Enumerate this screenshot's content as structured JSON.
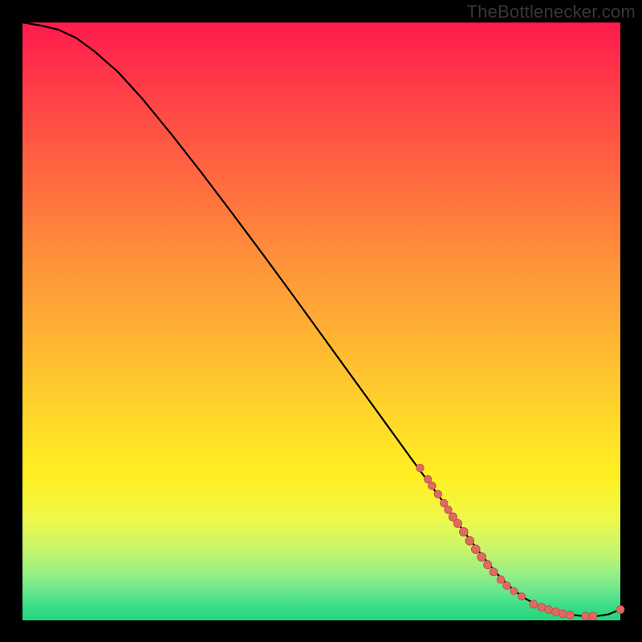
{
  "watermark": "TheBottlenecker.com",
  "colors": {
    "curve": "#000000",
    "marker_fill": "#e06a62",
    "marker_stroke": "#b94f47",
    "gradient_top": "#ff1a4e",
    "gradient_bottom": "#1fd77d"
  },
  "chart_data": {
    "type": "line",
    "title": "",
    "xlabel": "",
    "ylabel": "",
    "xlim": [
      0,
      100
    ],
    "ylim": [
      0,
      100
    ],
    "grid": false,
    "legend": false,
    "series": [
      {
        "name": "curve",
        "x": [
          0,
          3,
          6,
          9,
          12,
          16,
          20,
          25,
          30,
          35,
          40,
          45,
          50,
          55,
          60,
          65,
          70,
          74,
          78,
          80,
          82,
          84,
          86,
          88,
          90,
          92,
          94,
          96,
          98,
          100
        ],
        "y": [
          100,
          99.5,
          98.8,
          97.4,
          95.2,
          91.7,
          87.3,
          81.2,
          74.8,
          68.2,
          61.5,
          54.7,
          47.8,
          40.9,
          34.0,
          27.1,
          20.3,
          14.6,
          9.4,
          7.1,
          5.2,
          3.7,
          2.6,
          1.8,
          1.2,
          0.9,
          0.7,
          0.7,
          1.0,
          1.8
        ]
      }
    ],
    "markers": [
      {
        "x": 66.5,
        "y": 25.5,
        "r": 4.8
      },
      {
        "x": 67.8,
        "y": 23.6,
        "r": 4.8
      },
      {
        "x": 68.5,
        "y": 22.5,
        "r": 4.8
      },
      {
        "x": 69.5,
        "y": 21.1,
        "r": 4.8
      },
      {
        "x": 70.5,
        "y": 19.6,
        "r": 4.8
      },
      {
        "x": 71.2,
        "y": 18.5,
        "r": 4.8
      },
      {
        "x": 72.0,
        "y": 17.3,
        "r": 5.2
      },
      {
        "x": 72.8,
        "y": 16.2,
        "r": 5.2
      },
      {
        "x": 73.8,
        "y": 14.8,
        "r": 5.4
      },
      {
        "x": 74.8,
        "y": 13.3,
        "r": 5.4
      },
      {
        "x": 75.8,
        "y": 11.9,
        "r": 5.4
      },
      {
        "x": 76.8,
        "y": 10.6,
        "r": 5.4
      },
      {
        "x": 77.8,
        "y": 9.3,
        "r": 5.2
      },
      {
        "x": 78.8,
        "y": 8.1,
        "r": 5.0
      },
      {
        "x": 80.0,
        "y": 6.8,
        "r": 4.8
      },
      {
        "x": 81.0,
        "y": 5.8,
        "r": 4.8
      },
      {
        "x": 82.2,
        "y": 4.9,
        "r": 4.6
      },
      {
        "x": 83.5,
        "y": 4.0,
        "r": 4.6
      },
      {
        "x": 85.5,
        "y": 2.7,
        "r": 5.0
      },
      {
        "x": 86.8,
        "y": 2.2,
        "r": 5.0
      },
      {
        "x": 88.0,
        "y": 1.8,
        "r": 5.0
      },
      {
        "x": 89.2,
        "y": 1.4,
        "r": 5.0
      },
      {
        "x": 90.4,
        "y": 1.1,
        "r": 5.0
      },
      {
        "x": 91.6,
        "y": 0.9,
        "r": 5.0
      },
      {
        "x": 94.2,
        "y": 0.7,
        "r": 5.0
      },
      {
        "x": 95.4,
        "y": 0.7,
        "r": 5.0
      },
      {
        "x": 100.0,
        "y": 1.8,
        "r": 5.0
      }
    ]
  }
}
